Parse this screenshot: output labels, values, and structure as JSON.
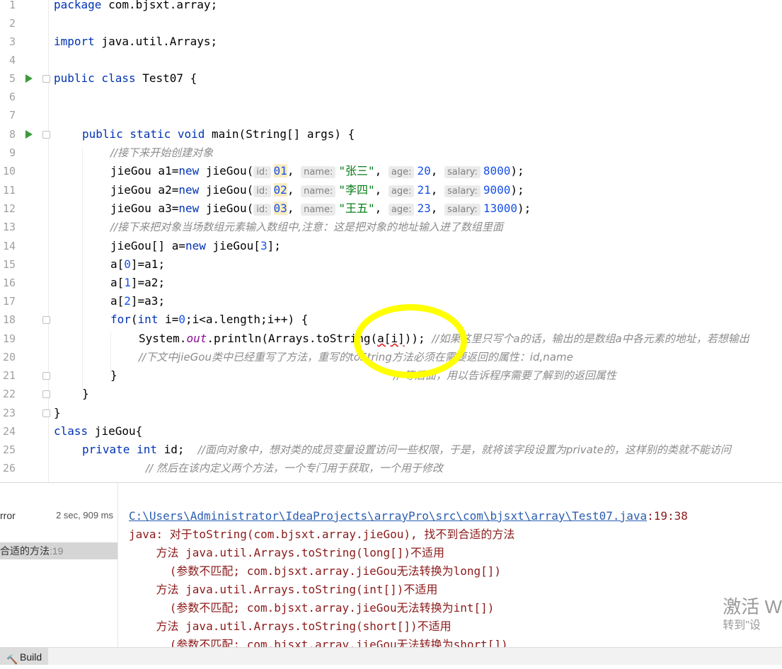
{
  "editor": {
    "line_numbers": [
      "1",
      "2",
      "3",
      "4",
      "5",
      "6",
      "7",
      "8",
      "9",
      "10",
      "11",
      "12",
      "13",
      "14",
      "15",
      "16",
      "17",
      "18",
      "19",
      "20",
      "21",
      "22",
      "23",
      "24",
      "25",
      "26"
    ],
    "code": {
      "l1_kw": "package",
      "l1_rest": " com.bjsxt.array;",
      "l3_kw": "import",
      "l3_rest": " java.util.Arrays;",
      "l5_kw": "public class",
      "l5_rest": " Test07 {",
      "l8_kw": "public static void",
      "l8_rest": " main(String[] args) {",
      "l9_cm": "//接下来开始创建对象",
      "obj_prefix_1": "jieGou a1=",
      "obj_prefix_2": "jieGou a2=",
      "obj_prefix_3": "jieGou a3=",
      "new_kw": "new",
      "ctor_call": " jieGou(",
      "hint_id": "id:",
      "hint_name": "name:",
      "hint_age": "age:",
      "hint_salary": "salary:",
      "comma": ", ",
      "close_paren": ");",
      "a1_id": "01",
      "a1_name": "\"张三\"",
      "a1_age": "20",
      "a1_salary": "8000",
      "a2_id": "02",
      "a2_name": "\"李四\"",
      "a2_age": "21",
      "a2_salary": "9000",
      "a3_id": "03",
      "a3_name": "\"王五\"",
      "a3_age": "23",
      "a3_salary": "13000",
      "l13_cm": "//接下来把对象当场数组元素输入数组中,注意：这是把对象的地址输入进了数组里面",
      "l14_a": "jieGou[] a=",
      "l14_b": " jieGou[",
      "l14_num": "3",
      "l14_c": "];",
      "l15_a": "a[",
      "l15_num": "0",
      "l15_b": "]=a1;",
      "l16_a": "a[",
      "l16_num": "1",
      "l16_b": "]=a2;",
      "l17_a": "a[",
      "l17_num": "2",
      "l17_b": "]=a3;",
      "l18_kw": "for",
      "l18_a": "(",
      "l18_kw2": "int",
      "l18_b": " i=",
      "l18_num": "0",
      "l18_c": ";i<a.length;i++) {",
      "l19_a": "System.",
      "l19_out": "out",
      "l19_b": ".println(Arrays.toString(",
      "l19_sq": "a[i]",
      "l19_c": ")); ",
      "l19_cm": "//如果这里只写个a的话，输出的是数组a中各元素的地址，若想输出",
      "l20_cm": "//下文中jieGou类中已经重写了方法，重写的toString方法必须在需要返回的属性：id,name",
      "l21_brace": "}",
      "l21_cm": "// 等后面，用以告诉程序需要了解到的返回属性",
      "l22_brace": "}",
      "l23_brace": "}",
      "l24_kw": "class",
      "l24_rest": " jieGou{",
      "l25_kw": "private int",
      "l25_rest": " id;  ",
      "l25_cm": "//面向对象中，想对类的成员变量设置访问一些权限，于是，就将该字段设置为private的，这样别的类就不能访问",
      "l26_cm": "// 然后在该内定义两个方法，一个专门用于获取，一个用于修改"
    }
  },
  "build_panel": {
    "tree": {
      "row1_label": "rror",
      "row1_time": "2 sec, 909 ms",
      "row2_label": "合适的方法",
      "row2_line": ":19"
    },
    "messages": {
      "path": "C:\\Users\\Administrator\\IdeaProjects\\arrayPro\\src\\com\\bjsxt\\array\\Test07.java",
      "path_suffix": ":19:38",
      "m1": "java: 对于toString(com.bjsxt.array.jieGou), 找不到合适的方法",
      "m2": "    方法 java.util.Arrays.toString(long[])不适用",
      "m3": "      (参数不匹配; com.bjsxt.array.jieGou无法转换为long[])",
      "m4": "    方法 java.util.Arrays.toString(int[])不适用",
      "m5": "      (参数不匹配; com.bjsxt.array.jieGou无法转换为int[])",
      "m6": "    方法 java.util.Arrays.toString(short[])不适用",
      "m7": "      (参数不匹配; com.bjsxt.array.jieGou无法转换为short[])"
    },
    "tab_label": "Build",
    "tab_icon": "hammer-icon"
  },
  "watermark": {
    "line1": "激活 W",
    "line2": "转到\"设"
  },
  "colors": {
    "keyword": "#0033b3",
    "comment": "#8c8c8c",
    "string": "#067d17",
    "number": "#1750eb",
    "error_text": "#8b1a1a",
    "annotation_circle": "#ffff00"
  }
}
